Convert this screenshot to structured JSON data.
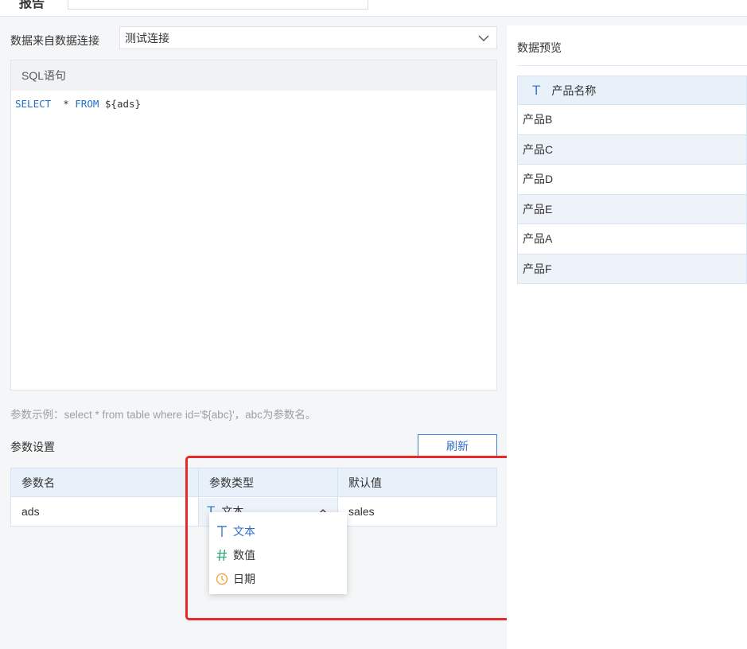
{
  "topbar": {
    "title_fragment": "报告",
    "name_value": ""
  },
  "connection": {
    "label": "数据来自数据连接",
    "selected": "测试连接"
  },
  "sql": {
    "header": "SQL语句",
    "code": {
      "kw1": "SELECT",
      "mid": "  * ",
      "kw2": "FROM",
      "rest": " ${ads}"
    }
  },
  "hint": "参数示例：select * from table where id='${abc}'，abc为参数名。",
  "params": {
    "title": "参数设置",
    "refresh_label": "刷新",
    "columns": [
      "参数名",
      "参数类型",
      "默认值"
    ],
    "rows": [
      {
        "name": "ads",
        "type": "文本",
        "default": "sales"
      }
    ],
    "type_options": [
      {
        "label": "文本",
        "icon": "text-type-icon"
      },
      {
        "label": "数值",
        "icon": "hash-icon"
      },
      {
        "label": "日期",
        "icon": "clock-icon"
      }
    ]
  },
  "preview": {
    "title": "数据预览",
    "column": "产品名称",
    "rows": [
      "产品B",
      "产品C",
      "产品D",
      "产品E",
      "产品A",
      "产品F"
    ]
  },
  "colors": {
    "accent": "#2f6fc7",
    "highlight_frame": "#e62a2a",
    "number_icon": "#2aa876",
    "date_icon": "#f0a034"
  }
}
